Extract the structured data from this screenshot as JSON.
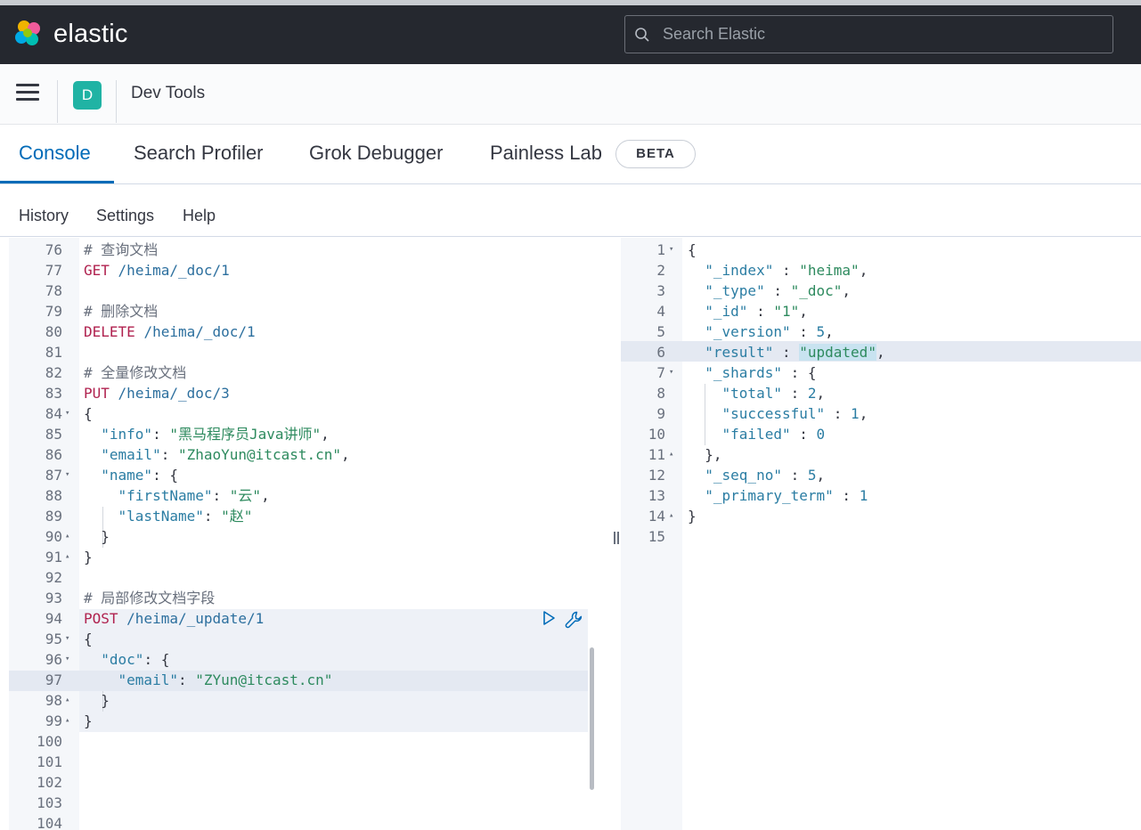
{
  "header": {
    "brand": "elastic",
    "search_placeholder": "Search Elastic"
  },
  "breadcrumb": {
    "space_initial": "D",
    "title": "Dev Tools"
  },
  "tabs": [
    {
      "label": "Console",
      "active": true
    },
    {
      "label": "Search Profiler",
      "active": false
    },
    {
      "label": "Grok Debugger",
      "active": false
    },
    {
      "label": "Painless Lab",
      "active": false
    }
  ],
  "beta_badge": "BETA",
  "console_menu": {
    "history": "History",
    "settings": "Settings",
    "help": "Help"
  },
  "request_editor": {
    "lines": [
      {
        "n": "76",
        "text": "# 查询文档"
      },
      {
        "n": "77",
        "text": "GET /heima/_doc/1"
      },
      {
        "n": "78",
        "text": ""
      },
      {
        "n": "79",
        "text": "# 删除文档"
      },
      {
        "n": "80",
        "text": "DELETE /heima/_doc/1"
      },
      {
        "n": "81",
        "text": ""
      },
      {
        "n": "82",
        "text": "# 全量修改文档"
      },
      {
        "n": "83",
        "text": "PUT /heima/_doc/3"
      },
      {
        "n": "84",
        "text": "{"
      },
      {
        "n": "85",
        "text": "  \"info\": \"黑马程序员Java讲师\","
      },
      {
        "n": "86",
        "text": "  \"email\": \"ZhaoYun@itcast.cn\","
      },
      {
        "n": "87",
        "text": "  \"name\": {"
      },
      {
        "n": "88",
        "text": "    \"firstName\": \"云\","
      },
      {
        "n": "89",
        "text": "    \"lastName\": \"赵\""
      },
      {
        "n": "90",
        "text": "  }"
      },
      {
        "n": "91",
        "text": "}"
      },
      {
        "n": "92",
        "text": ""
      },
      {
        "n": "93",
        "text": "# 局部修改文档字段"
      },
      {
        "n": "94",
        "text": "POST /heima/_update/1"
      },
      {
        "n": "95",
        "text": "{"
      },
      {
        "n": "96",
        "text": "  \"doc\": {"
      },
      {
        "n": "97",
        "text": "    \"email\": \"ZYun@itcast.cn\""
      },
      {
        "n": "98",
        "text": "  }"
      },
      {
        "n": "99",
        "text": "}"
      },
      {
        "n": "100",
        "text": ""
      },
      {
        "n": "101",
        "text": ""
      },
      {
        "n": "102",
        "text": ""
      },
      {
        "n": "103",
        "text": ""
      },
      {
        "n": "104",
        "text": ""
      }
    ]
  },
  "response_editor": {
    "lines": [
      {
        "n": "1",
        "text": "{"
      },
      {
        "n": "2",
        "text": "  \"_index\" : \"heima\","
      },
      {
        "n": "3",
        "text": "  \"_type\" : \"_doc\","
      },
      {
        "n": "4",
        "text": "  \"_id\" : \"1\","
      },
      {
        "n": "5",
        "text": "  \"_version\" : 5,"
      },
      {
        "n": "6",
        "text": "  \"result\" : \"updated\","
      },
      {
        "n": "7",
        "text": "  \"_shards\" : {"
      },
      {
        "n": "8",
        "text": "    \"total\" : 2,"
      },
      {
        "n": "9",
        "text": "    \"successful\" : 1,"
      },
      {
        "n": "10",
        "text": "    \"failed\" : 0"
      },
      {
        "n": "11",
        "text": "  },"
      },
      {
        "n": "12",
        "text": "  \"_seq_no\" : 5,"
      },
      {
        "n": "13",
        "text": "  \"_primary_term\" : 1"
      },
      {
        "n": "14",
        "text": "}"
      },
      {
        "n": "15",
        "text": ""
      }
    ]
  },
  "icons": {
    "logo": "elastic-logo-icon",
    "search": "search-icon",
    "menu": "hamburger-menu-icon",
    "run": "play-icon",
    "wrench": "wrench-icon"
  },
  "colors": {
    "header_bg": "#25282f",
    "accent": "#006bb8",
    "space_avatar": "#20b3a4",
    "method": "#b0224f",
    "string": "#2d8a5e",
    "key": "#2b7da3"
  }
}
